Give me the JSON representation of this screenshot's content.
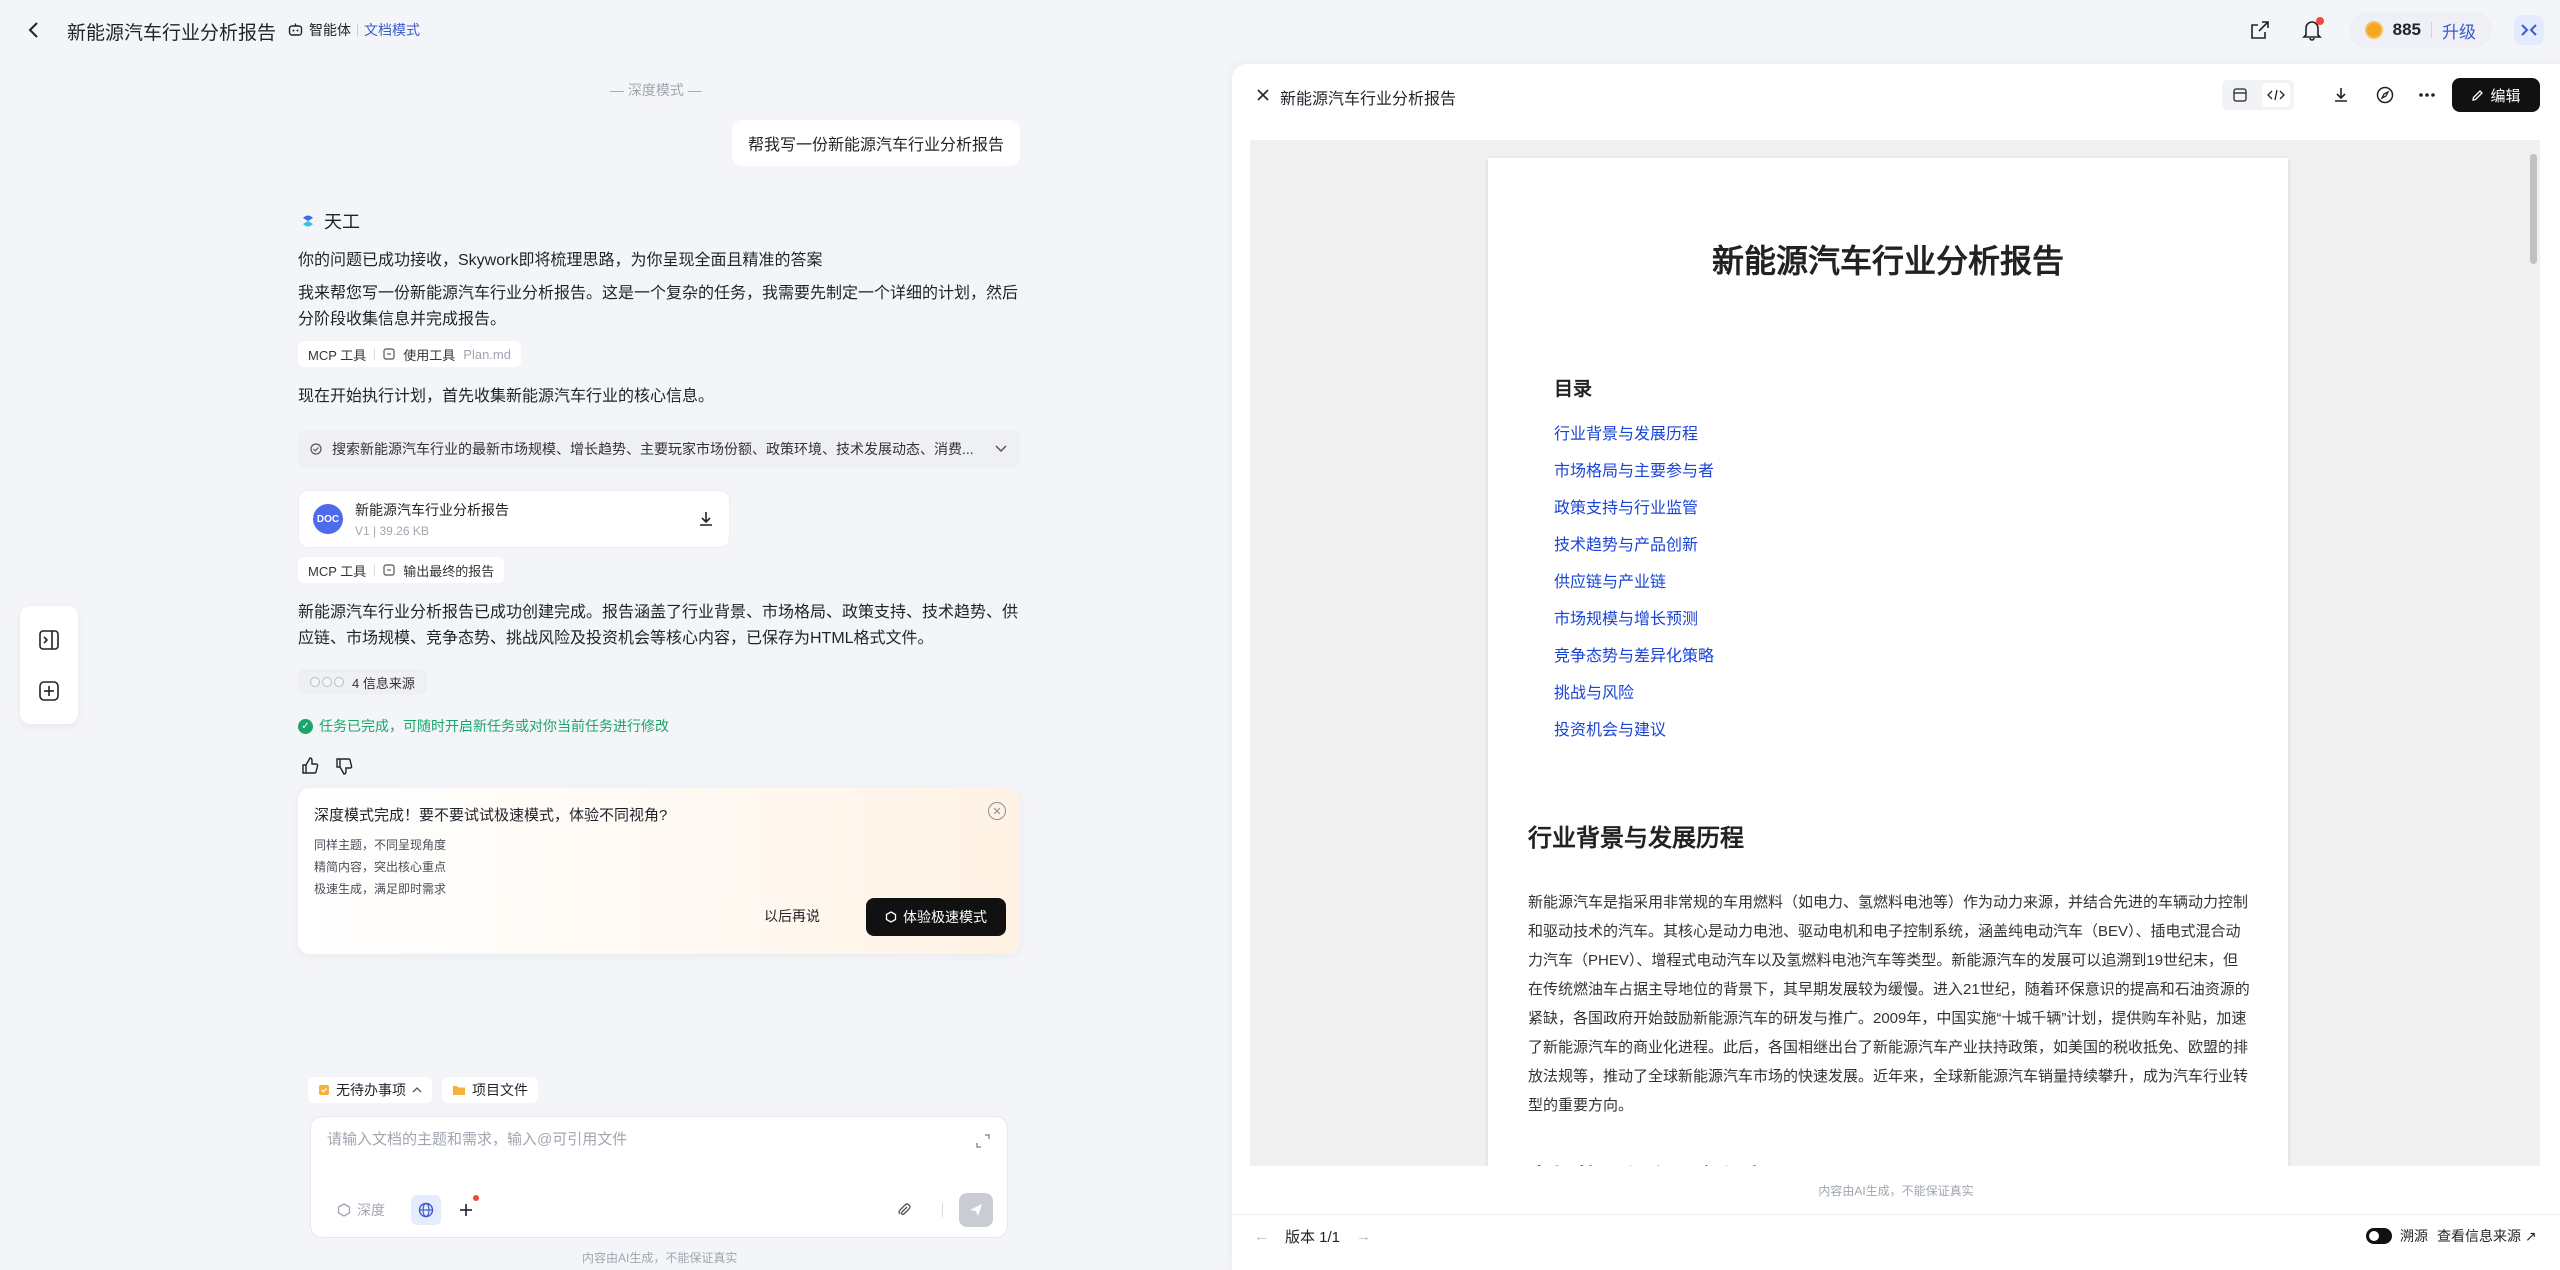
{
  "header": {
    "title": "新能源汽车行业分析报告",
    "agent_label": "智能体",
    "mode_label": "文档模式",
    "credits": "885",
    "upgrade_label": "升级"
  },
  "chat": {
    "mode_divider": "— 深度模式 —",
    "user_message": "帮我写一份新能源汽车行业分析报告",
    "bot_name": "天工",
    "msg_received": "你的问题已成功接收，Skywork即将梳理思路，为你呈现全面且精准的答案",
    "msg_plan": "我来帮您写一份新能源汽车行业分析报告。这是一个复杂的任务，我需要先制定一个详细的计划，然后分阶段收集信息并完成报告。",
    "tag1": {
      "tool": "MCP 工具",
      "action": "使用工具",
      "file": "Plan.md"
    },
    "msg_start": "现在开始执行计划，首先收集新能源汽车行业的核心信息。",
    "search_text": "搜索新能源汽车行业的最新市场规模、增长趋势、主要玩家市场份额、政策环境、技术发展动态、消费...",
    "doc_card": {
      "badge": "DOC",
      "name": "新能源汽车行业分析报告",
      "version": "V1",
      "size": "39.26 KB"
    },
    "tag2": {
      "tool": "MCP 工具",
      "action": "输出最终的报告"
    },
    "msg_done": "新能源汽车行业分析报告已成功创建完成。报告涵盖了行业背景、市场格局、政策支持、技术趋势、供应链、市场规模、竞争态势、挑战风险及投资机会等核心内容，已保存为HTML格式文件。",
    "sources_label": "4 信息来源",
    "task_done": "任务已完成，可随时开启新任务或对你当前任务进行修改"
  },
  "promo": {
    "title": "深度模式完成！要不要试试极速模式，体验不同视角?",
    "lines": [
      "同样主题，不同呈现角度",
      "精简内容，突出核心重点",
      "极速生成，满足即时需求"
    ],
    "later": "以后再说",
    "try": "体验极速模式"
  },
  "composer": {
    "chip_todo": "无待办事项",
    "chip_files": "项目文件",
    "placeholder": "请输入文档的主题和需求，输入@可引用文件",
    "deep_label": "深度",
    "footnote": "内容由AI生成，不能保证真实"
  },
  "panel": {
    "title": "新能源汽车行业分析报告",
    "edit_label": "编辑",
    "footnote": "内容由AI生成，不能保证真实",
    "version": "版本 1/1",
    "trace_label": "溯源",
    "source_link": "查看信息来源 ↗"
  },
  "document": {
    "title": "新能源汽车行业分析报告",
    "toc_title": "目录",
    "toc": [
      "行业背景与发展历程",
      "市场格局与主要参与者",
      "政策支持与行业监管",
      "技术趋势与产品创新",
      "供应链与产业链",
      "市场规模与增长预测",
      "竞争态势与差异化策略",
      "挑战与风险",
      "投资机会与建议"
    ],
    "section1_title": "行业背景与发展历程",
    "section1_body": "新能源汽车是指采用非常规的车用燃料（如电力、氢燃料电池等）作为动力来源，并结合先进的车辆动力控制和驱动技术的汽车。其核心是动力电池、驱动电机和电子控制系统，涵盖纯电动汽车（BEV）、插电式混合动力汽车（PHEV）、增程式电动汽车以及氢燃料电池汽车等类型。新能源汽车的发展可以追溯到19世纪末，但在传统燃油车占据主导地位的背景下，其早期发展较为缓慢。进入21世纪，随着环保意识的提高和石油资源的紧缺，各国政府开始鼓励新能源汽车的研发与推广。2009年，中国实施“十城千辆”计划，提供购车补贴，加速了新能源汽车的商业化进程。此后，各国相继出台了新能源汽车产业扶持政策，如美国的税收抵免、欧盟的排放法规等，推动了全球新能源汽车市场的快速发展。近年来，全球新能源汽车销量持续攀升，成为汽车行业转型的重要方向。",
    "section2_title": "市场格局与主要参与者"
  }
}
